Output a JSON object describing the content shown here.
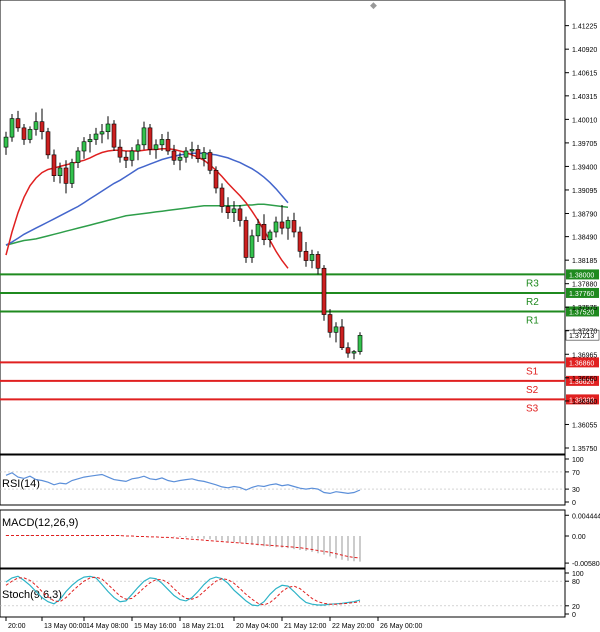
{
  "chart_data": {
    "type": "candlestick",
    "current_price": "1.37213",
    "y_ticks": [
      "1.41225",
      "1.40920",
      "1.40615",
      "1.40315",
      "1.40010",
      "1.39705",
      "1.39400",
      "1.39095",
      "1.38790",
      "1.38490",
      "1.38185",
      "1.37880",
      "1.37575",
      "1.37270",
      "1.36965",
      "1.36660",
      "1.36360",
      "1.36055",
      "1.35750"
    ],
    "ylim": [
      1.3575,
      1.4135
    ],
    "x_ticks": [
      {
        "i": 0,
        "label": "20:00"
      },
      {
        "i": 6,
        "label": "13 May 00:00"
      },
      {
        "i": 13,
        "label": "14 May 08:00"
      },
      {
        "i": 21,
        "label": "15 May 16:00"
      },
      {
        "i": 29,
        "label": "18 May 21:01"
      },
      {
        "i": 38,
        "label": "20 May 04:00"
      },
      {
        "i": 46,
        "label": "21 May 12:00"
      },
      {
        "i": 54,
        "label": "22 May 20:00"
      },
      {
        "i": 62,
        "label": "26 May 00:00"
      }
    ],
    "levels": [
      {
        "name": "R3",
        "value": 1.38,
        "label": "1.38000",
        "color": "#1f8a1f"
      },
      {
        "name": "R2",
        "value": 1.3776,
        "label": "1.37760",
        "color": "#1f8a1f"
      },
      {
        "name": "R1",
        "value": 1.3752,
        "label": "1.37520",
        "color": "#1f8a1f"
      },
      {
        "name": "S1",
        "value": 1.3686,
        "label": "1.36860",
        "color": "#e02020"
      },
      {
        "name": "S2",
        "value": 1.3662,
        "label": "1.36620",
        "color": "#e02020"
      },
      {
        "name": "S3",
        "value": 1.3638,
        "label": "1.36380",
        "color": "#e02020"
      }
    ],
    "candles": [
      [
        1.3965,
        1.3985,
        1.3955,
        1.3978
      ],
      [
        1.3978,
        1.4008,
        1.3972,
        1.4002
      ],
      [
        1.4002,
        1.4012,
        1.3985,
        1.399
      ],
      [
        1.399,
        1.3995,
        1.3968,
        1.3975
      ],
      [
        1.3975,
        1.3992,
        1.397,
        1.3988
      ],
      [
        1.3988,
        1.401,
        1.398,
        1.3998
      ],
      [
        1.3998,
        1.4015,
        1.3975,
        1.3985
      ],
      [
        1.3985,
        1.399,
        1.395,
        1.3955
      ],
      [
        1.3955,
        1.3962,
        1.392,
        1.3928
      ],
      [
        1.3928,
        1.3945,
        1.3918,
        1.3938
      ],
      [
        1.3938,
        1.3948,
        1.3905,
        1.3918
      ],
      [
        1.3918,
        1.395,
        1.3912,
        1.3945
      ],
      [
        1.3945,
        1.3965,
        1.3938,
        1.396
      ],
      [
        1.396,
        1.3978,
        1.395,
        1.3972
      ],
      [
        1.3972,
        1.3982,
        1.3958,
        1.3975
      ],
      [
        1.3975,
        1.399,
        1.3968,
        1.3982
      ],
      [
        1.3982,
        1.3995,
        1.397,
        1.3985
      ],
      [
        1.3985,
        1.4005,
        1.3975,
        1.3995
      ],
      [
        1.3995,
        1.4,
        1.396,
        1.3965
      ],
      [
        1.3965,
        1.3975,
        1.3945,
        1.3952
      ],
      [
        1.3952,
        1.396,
        1.3938,
        1.3948
      ],
      [
        1.3948,
        1.3965,
        1.394,
        1.396
      ],
      [
        1.396,
        1.3975,
        1.3948,
        1.3968
      ],
      [
        1.3968,
        1.3998,
        1.3962,
        1.399
      ],
      [
        1.399,
        1.3995,
        1.3955,
        1.3962
      ],
      [
        1.3962,
        1.3975,
        1.395,
        1.3968
      ],
      [
        1.3968,
        1.3982,
        1.396,
        1.3975
      ],
      [
        1.3975,
        1.3985,
        1.3955,
        1.396
      ],
      [
        1.396,
        1.3968,
        1.3942,
        1.3948
      ],
      [
        1.3948,
        1.3958,
        1.3935,
        1.3952
      ],
      [
        1.3952,
        1.3965,
        1.3945,
        1.396
      ],
      [
        1.396,
        1.3972,
        1.395,
        1.3962
      ],
      [
        1.3962,
        1.3968,
        1.3945,
        1.395
      ],
      [
        1.395,
        1.3965,
        1.394,
        1.3958
      ],
      [
        1.3958,
        1.3962,
        1.393,
        1.3935
      ],
      [
        1.3935,
        1.394,
        1.3905,
        1.3912
      ],
      [
        1.3912,
        1.3918,
        1.388,
        1.3888
      ],
      [
        1.3888,
        1.39,
        1.3872,
        1.388
      ],
      [
        1.388,
        1.3895,
        1.3868,
        1.3885
      ],
      [
        1.3885,
        1.389,
        1.3862,
        1.387
      ],
      [
        1.387,
        1.3875,
        1.3815,
        1.3822
      ],
      [
        1.3822,
        1.3858,
        1.3815,
        1.385
      ],
      [
        1.385,
        1.3872,
        1.3842,
        1.3865
      ],
      [
        1.3865,
        1.3878,
        1.3838,
        1.3845
      ],
      [
        1.3845,
        1.3858,
        1.3835,
        1.3855
      ],
      [
        1.3855,
        1.3875,
        1.3848,
        1.3868
      ],
      [
        1.3868,
        1.389,
        1.3852,
        1.386
      ],
      [
        1.386,
        1.3875,
        1.3845,
        1.387
      ],
      [
        1.387,
        1.388,
        1.3848,
        1.3855
      ],
      [
        1.3855,
        1.3862,
        1.3822,
        1.383
      ],
      [
        1.383,
        1.3842,
        1.381,
        1.3818
      ],
      [
        1.3818,
        1.3832,
        1.3808,
        1.3826
      ],
      [
        1.3826,
        1.383,
        1.38,
        1.3808
      ],
      [
        1.3808,
        1.3812,
        1.374,
        1.3748
      ],
      [
        1.3748,
        1.3755,
        1.3718,
        1.3725
      ],
      [
        1.3725,
        1.3738,
        1.3712,
        1.3732
      ],
      [
        1.3732,
        1.3742,
        1.3702,
        1.3705
      ],
      [
        1.3705,
        1.3712,
        1.3692,
        1.3698
      ],
      [
        1.3698,
        1.3702,
        1.369,
        1.37
      ],
      [
        1.37,
        1.3725,
        1.3696,
        1.3721
      ]
    ],
    "ma_red": [
      1.3825,
      1.3855,
      1.388,
      1.39,
      1.3915,
      1.3925,
      1.3932,
      1.3936,
      1.3938,
      1.394,
      1.3942,
      1.3944,
      1.3946,
      1.3948,
      1.3951,
      1.3955,
      1.3958,
      1.396,
      1.3961,
      1.3961,
      1.396,
      1.396,
      1.396,
      1.3961,
      1.3962,
      1.3962,
      1.3963,
      1.3963,
      1.3962,
      1.396,
      1.3958,
      1.3955,
      1.3952,
      1.3948,
      1.3942,
      1.3935,
      1.3927,
      1.3918,
      1.391,
      1.3902,
      1.3893,
      1.3882,
      1.387,
      1.3857,
      1.3844,
      1.383,
      1.3818,
      1.3808
    ],
    "ma_red_start": 0,
    "ma_blue": [
      1.3838,
      1.3842,
      1.3847,
      1.3852,
      1.3856,
      1.386,
      1.3864,
      1.3868,
      1.3872,
      1.3876,
      1.388,
      1.3884,
      1.3888,
      1.3893,
      1.3898,
      1.3903,
      1.3908,
      1.3913,
      1.3918,
      1.3922,
      1.3927,
      1.3932,
      1.3937,
      1.394,
      1.3943,
      1.3946,
      1.3949,
      1.3951,
      1.3953,
      1.3955,
      1.3956,
      1.3957,
      1.3957,
      1.3957,
      1.3956,
      1.3955,
      1.3953,
      1.3951,
      1.3948,
      1.3945,
      1.3941,
      1.3937,
      1.3932,
      1.3926,
      1.3919,
      1.3911,
      1.3902,
      1.3893
    ],
    "ma_blue_start": 0,
    "ma_green": [
      1.3838,
      1.384,
      1.3842,
      1.3844,
      1.3845,
      1.3846,
      1.3848,
      1.385,
      1.3852,
      1.3854,
      1.3856,
      1.3858,
      1.386,
      1.3862,
      1.3864,
      1.3866,
      1.3868,
      1.387,
      1.3872,
      1.3874,
      1.3876,
      1.3877,
      1.3878,
      1.3879,
      1.388,
      1.3881,
      1.3882,
      1.3883,
      1.3884,
      1.3885,
      1.3886,
      1.3887,
      1.3888,
      1.3889,
      1.3889,
      1.3889,
      1.3889,
      1.3889,
      1.3889,
      1.3889,
      1.389,
      1.389,
      1.3891,
      1.3891,
      1.389,
      1.3889,
      1.3888,
      1.3887
    ],
    "ma_green_start": 0,
    "rsi": {
      "label": "RSI(14)",
      "ticks": [
        "100",
        "70",
        "30",
        "0"
      ],
      "values": [
        62,
        68,
        58,
        55,
        60,
        52,
        50,
        46,
        40,
        44,
        42,
        50,
        54,
        58,
        60,
        62,
        64,
        58,
        52,
        50,
        48,
        54,
        56,
        60,
        54,
        52,
        56,
        50,
        47,
        50,
        52,
        54,
        50,
        48,
        44,
        40,
        35,
        33,
        36,
        34,
        28,
        34,
        38,
        36,
        40,
        42,
        38,
        40,
        36,
        32,
        30,
        32,
        30,
        22,
        20,
        24,
        22,
        20,
        22,
        28
      ],
      "color": "#5b8fd9"
    },
    "macd": {
      "label": "MACD(12,26,9)",
      "ticks": [
        "0.004444",
        "0.00",
        "-0.005804"
      ],
      "ylim": [
        -0.006,
        0.0045
      ],
      "hist": [
        0.0001,
        0.0002,
        0.0002,
        0.0002,
        0.0002,
        0.0001,
        0.0001,
        0.0001,
        0.0001,
        0.0001,
        0.0001,
        0.0001,
        0.0001,
        0.0001,
        0.0001,
        0.0001,
        0.0001,
        0.0001,
        0.0001,
        0.0001,
        0.0,
        0.0,
        0.0,
        0.0,
        0.0,
        0.0,
        0.0,
        0.0,
        -0.0001,
        -0.0002,
        -0.0003,
        -0.0004,
        -0.0005,
        -0.0006,
        -0.0007,
        -0.0009,
        -0.001,
        -0.0012,
        -0.0013,
        -0.0015,
        -0.0017,
        -0.0019,
        -0.002,
        -0.0022,
        -0.0023,
        -0.0024,
        -0.0025,
        -0.0026,
        -0.0028,
        -0.003,
        -0.0032,
        -0.0034,
        -0.0037,
        -0.004,
        -0.0044,
        -0.0048,
        -0.0051,
        -0.0053,
        -0.0054,
        -0.0055
      ],
      "signal": [
        0.0001,
        0.0001,
        0.0001,
        0.0001,
        0.0001,
        0.0001,
        0.0001,
        0.0001,
        0.0001,
        0.0001,
        0.0001,
        0.0001,
        0.0001,
        0.0001,
        0.0001,
        0.0001,
        0.0001,
        0.0001,
        0.0001,
        0.0001,
        0.0,
        0.0,
        -0.0001,
        -0.0001,
        -0.0002,
        -0.0002,
        -0.0003,
        -0.0003,
        -0.0004,
        -0.0005,
        -0.0006,
        -0.0007,
        -0.0008,
        -0.0009,
        -0.001,
        -0.0011,
        -0.0012,
        -0.0013,
        -0.0014,
        -0.0015,
        -0.0016,
        -0.0017,
        -0.0018,
        -0.0019,
        -0.002,
        -0.0021,
        -0.0022,
        -0.0023,
        -0.0024,
        -0.0025,
        -0.0027,
        -0.0029,
        -0.0031,
        -0.0033,
        -0.0035,
        -0.0038,
        -0.0041,
        -0.0044,
        -0.0046,
        -0.0047
      ],
      "hist_color": "#999999",
      "signal_color": "#e02020"
    },
    "stoch": {
      "label": "Stoch(9,6,3)",
      "ticks": [
        "100",
        "80",
        "20",
        "0"
      ],
      "main": [
        78,
        88,
        92,
        82,
        70,
        55,
        40,
        30,
        25,
        35,
        55,
        70,
        82,
        90,
        92,
        88,
        72,
        55,
        40,
        30,
        32,
        48,
        65,
        80,
        88,
        86,
        75,
        60,
        45,
        35,
        32,
        40,
        55,
        72,
        85,
        90,
        86,
        75,
        58,
        45,
        32,
        22,
        20,
        30,
        48,
        62,
        70,
        68,
        55,
        40,
        28,
        24,
        22,
        22,
        24,
        25,
        26,
        28,
        30,
        34
      ],
      "signal": [
        70,
        80,
        88,
        88,
        82,
        70,
        55,
        42,
        32,
        30,
        40,
        55,
        68,
        80,
        88,
        90,
        85,
        72,
        58,
        44,
        36,
        38,
        50,
        64,
        76,
        84,
        84,
        76,
        62,
        48,
        38,
        36,
        42,
        55,
        68,
        80,
        86,
        84,
        75,
        62,
        48,
        36,
        26,
        22,
        28,
        40,
        55,
        65,
        68,
        62,
        50,
        38,
        30,
        26,
        24,
        24,
        25,
        26,
        28,
        30
      ],
      "main_color": "#2db3c7",
      "signal_color": "#e02020"
    }
  }
}
